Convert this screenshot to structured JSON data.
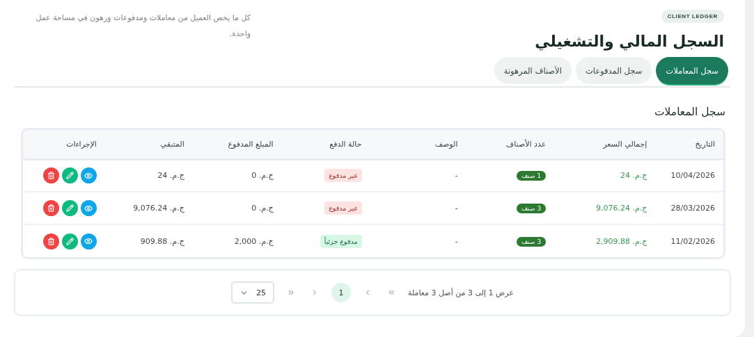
{
  "header": {
    "badge": "CLIENT LEDGER",
    "title": "السجل المالي والتشغيلي",
    "description": "كل ما يخص العميل من معاملات ومدفوعات ورهون في مساحة عمل واحدة."
  },
  "tabs": [
    {
      "label": "سجل المعاملات",
      "selected": true
    },
    {
      "label": "سجل المدفوعات",
      "selected": false
    },
    {
      "label": "الأصناف المرهونة",
      "selected": false
    }
  ],
  "section_title": "سجل المعاملات",
  "table": {
    "columns": [
      "التاريخ",
      "إجمالي السعر",
      "عدد الأصناف",
      "الوصف",
      "حالة الدفع",
      "المبلغ المدفوع",
      "المتبقي",
      "الإجراءات"
    ],
    "rows": [
      {
        "date": "10/04/2026",
        "total": "ج.م. 24",
        "count": "1 صنف",
        "description": "-",
        "status": {
          "label": "غير مدفوع",
          "kind": "unpaid"
        },
        "paid": "ج.م. 0",
        "remaining": "ج.م. 24"
      },
      {
        "date": "28/03/2026",
        "total": "ج.م. 9,076.24",
        "count": "3 صنف",
        "description": "-",
        "status": {
          "label": "غير مدفوع",
          "kind": "unpaid"
        },
        "paid": "ج.م. 0",
        "remaining": "ج.م. 9,076.24"
      },
      {
        "date": "11/02/2026",
        "total": "ج.م. 2,909.88",
        "count": "3 صنف",
        "description": "-",
        "status": {
          "label": "مدفوع جزئياً",
          "kind": "partial"
        },
        "paid": "ج.م. 2,000",
        "remaining": "ج.م. 909.88"
      }
    ]
  },
  "pagination": {
    "summary": "عرض 1 إلى 3 من أصل 3 معاملة",
    "pages": [
      {
        "label": "1",
        "selected": true
      }
    ],
    "page_size": "25"
  }
}
